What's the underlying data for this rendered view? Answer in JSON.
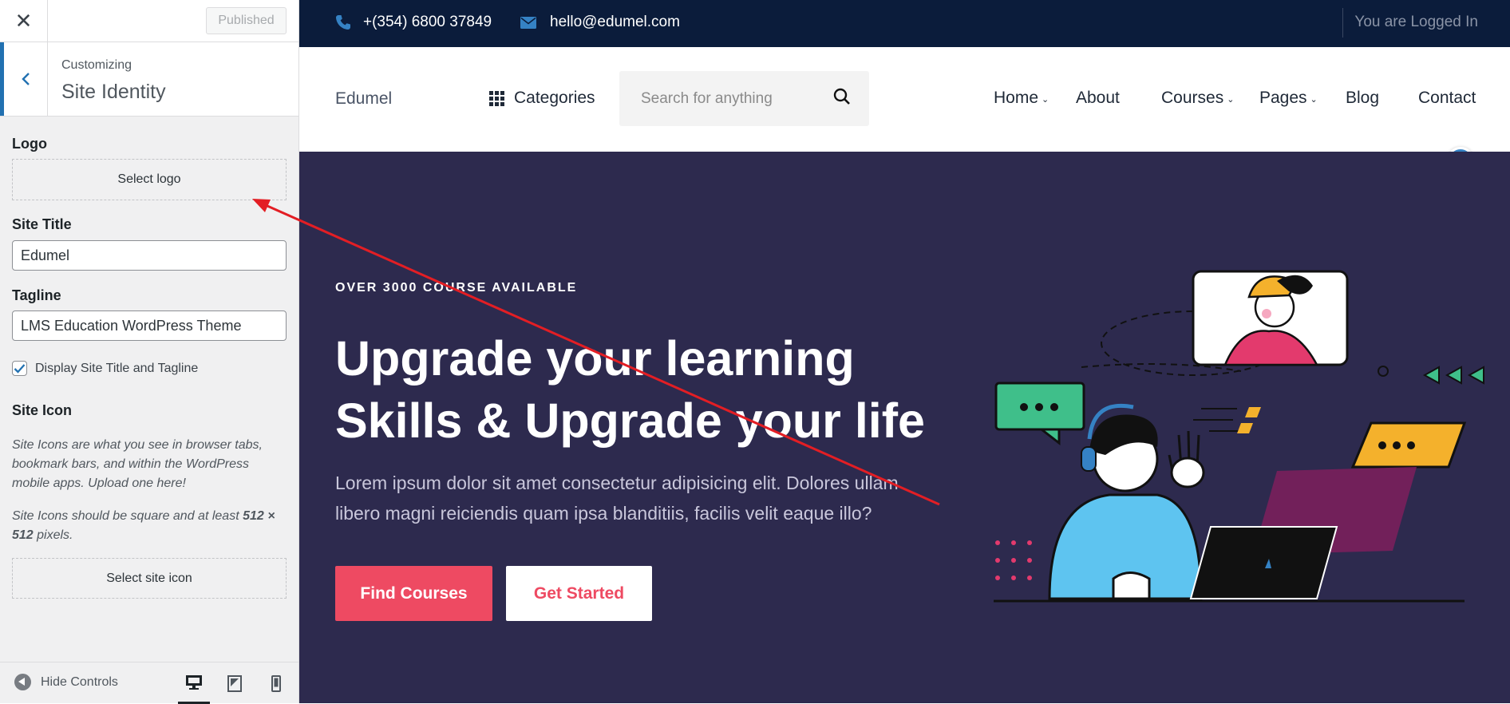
{
  "customizer": {
    "close_symbol": "✕",
    "publish_label": "Published",
    "breadcrumb": "Customizing",
    "section_title": "Site Identity",
    "logo": {
      "label": "Logo",
      "button": "Select logo"
    },
    "site_title": {
      "label": "Site Title",
      "value": "Edumel"
    },
    "tagline": {
      "label": "Tagline",
      "value": "LMS Education WordPress Theme"
    },
    "display_title_tagline": {
      "label": "Display Site Title and Tagline",
      "checked": true
    },
    "site_icon": {
      "label": "Site Icon",
      "desc1": "Site Icons are what you see in browser tabs, bookmark bars, and within the WordPress mobile apps. Upload one here!",
      "desc2_pre": "Site Icons should be square and at least ",
      "desc2_bold": "512 × 512",
      "desc2_post": " pixels.",
      "button": "Select site icon"
    },
    "footer": {
      "hide_controls": "Hide Controls",
      "active_device": "desktop"
    }
  },
  "site": {
    "topbar": {
      "phone": "+(354) 6800 37849",
      "email": "hello@edumel.com",
      "logged_in": "You are Logged In"
    },
    "header": {
      "brand": "Edumel",
      "categories": "Categories",
      "search_placeholder": "Search for anything",
      "nav": [
        "Home",
        "About",
        "Courses",
        "Pages",
        "Blog",
        "Contact"
      ]
    },
    "hero": {
      "eyebrow": "OVER 3000 COURSE AVAILABLE",
      "title_line1": "Upgrade your learning",
      "title_line2": "Skills & Upgrade your life",
      "description": "Lorem ipsum dolor sit amet consectetur adipisicing elit. Dolores ullam libero magni reiciendis quam ipsa blanditiis, facilis velit eaque illo?",
      "primary_button": "Find Courses",
      "secondary_button": "Get Started"
    }
  },
  "colors": {
    "accent": "#2271b1",
    "navy": "#0b1c3b",
    "hero_bg": "#2d2a4e",
    "brand_red": "#ee4a62",
    "annotation": "#e31e24"
  }
}
